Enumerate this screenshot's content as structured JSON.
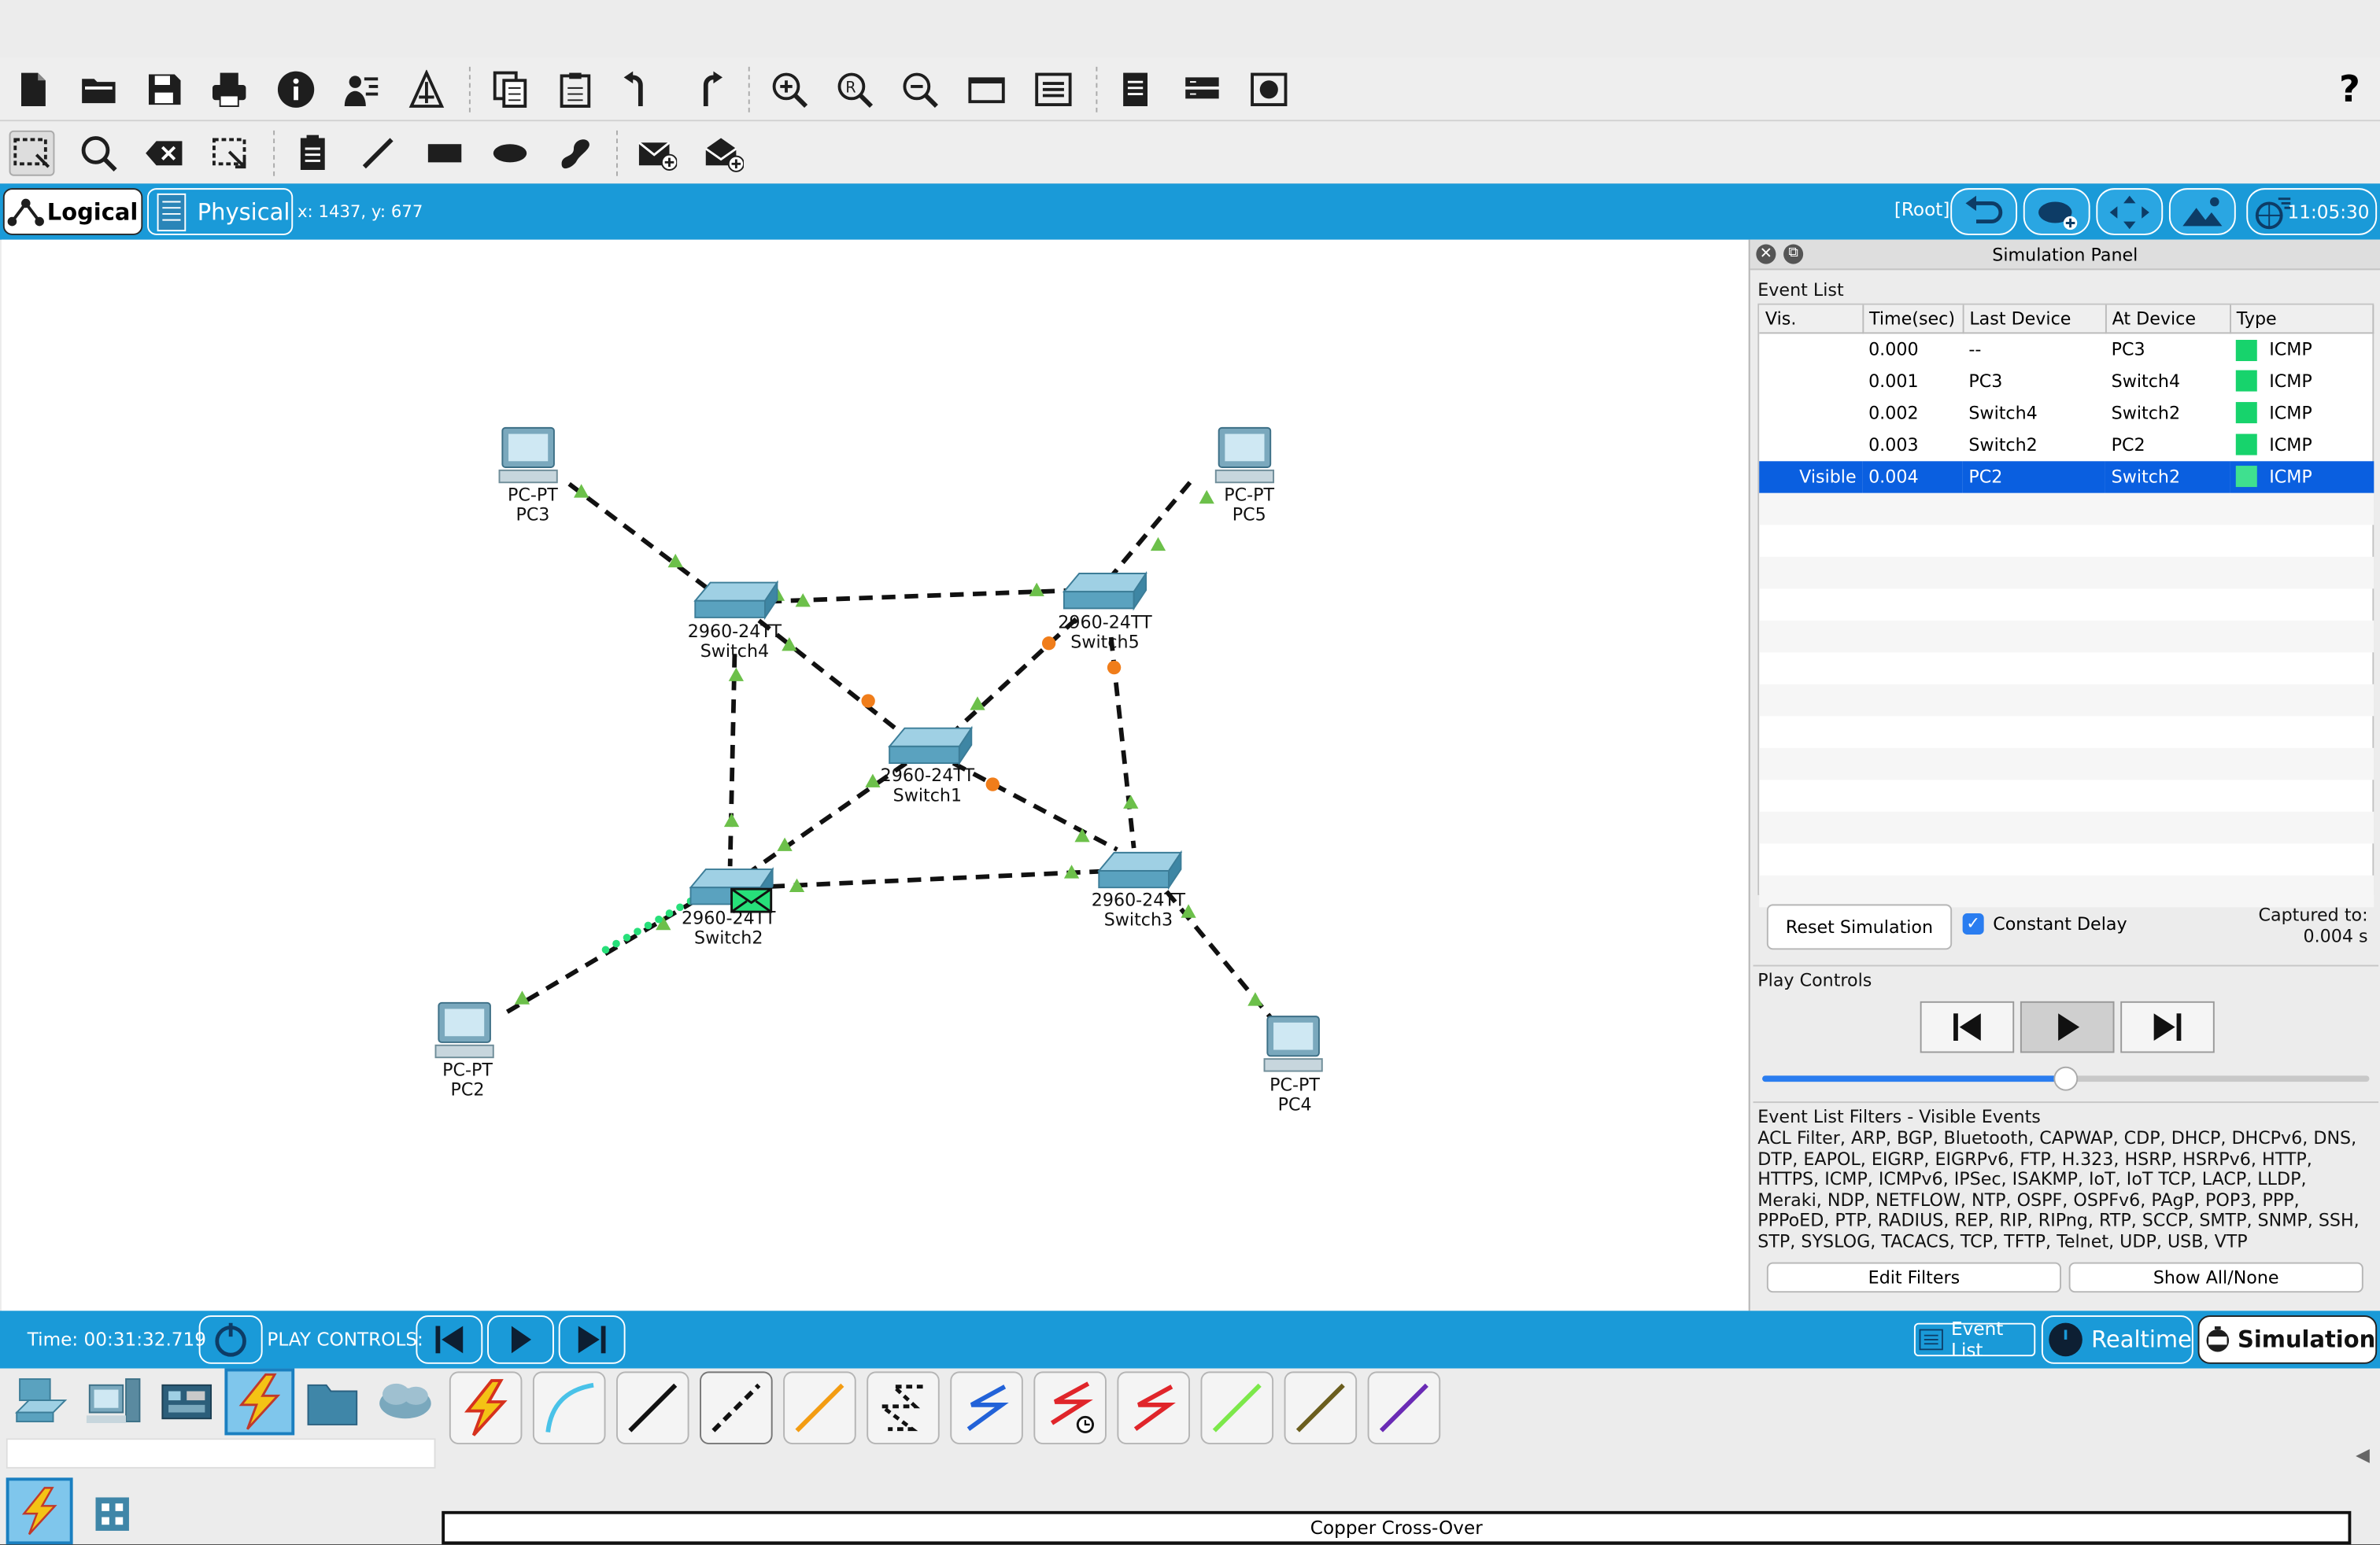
{
  "toolbar": {
    "help_label": "?"
  },
  "nav": {
    "logical_label": "Logical",
    "physical_label": "Physical",
    "coords": "x: 1437, y: 677",
    "root_label": "[Root]",
    "time": "11:05:30"
  },
  "devices": {
    "pc3": {
      "model": "PC-PT",
      "name": "PC3"
    },
    "pc5": {
      "model": "PC-PT",
      "name": "PC5"
    },
    "pc2": {
      "model": "PC-PT",
      "name": "PC2"
    },
    "pc4": {
      "model": "PC-PT",
      "name": "PC4"
    },
    "sw4": {
      "model": "2960-24TT",
      "name": "Switch4"
    },
    "sw5": {
      "model": "2960-24TT",
      "name": "Switch5"
    },
    "sw1": {
      "model": "2960-24TT",
      "name": "Switch1"
    },
    "sw2": {
      "model": "2960-24TT",
      "name": "Switch2"
    },
    "sw3": {
      "model": "2960-24TT",
      "name": "Switch3"
    }
  },
  "sim": {
    "title": "Simulation Panel",
    "event_list_label": "Event List",
    "columns": [
      "Vis.",
      "Time(sec)",
      "Last Device",
      "At Device",
      "Type"
    ],
    "events": [
      {
        "vis": "",
        "time": "0.000",
        "last": "--",
        "at": "PC3",
        "type": "ICMP"
      },
      {
        "vis": "",
        "time": "0.001",
        "last": "PC3",
        "at": "Switch4",
        "type": "ICMP"
      },
      {
        "vis": "",
        "time": "0.002",
        "last": "Switch4",
        "at": "Switch2",
        "type": "ICMP"
      },
      {
        "vis": "",
        "time": "0.003",
        "last": "Switch2",
        "at": "PC2",
        "type": "ICMP"
      },
      {
        "vis": "Visible",
        "time": "0.004",
        "last": "PC2",
        "at": "Switch2",
        "type": "ICMP"
      }
    ],
    "reset_label": "Reset Simulation",
    "constant_delay_label": "Constant Delay",
    "captured_label": "Captured to:",
    "captured_value": "0.004 s",
    "play_controls_label": "Play Controls",
    "slider_fraction": 0.5,
    "filters_title": "Event List Filters - Visible Events",
    "filters_text": "ACL Filter, ARP, BGP, Bluetooth, CAPWAP, CDP, DHCP, DHCPv6, DNS, DTP, EAPOL, EIGRP, EIGRPv6, FTP, H.323, HSRP, HSRPv6, HTTP, HTTPS, ICMP, ICMPv6, IPSec, ISAKMP, IoT, IoT TCP, LACP, LLDP, Meraki, NDP, NETFLOW, NTP, OSPF, OSPFv6, PAgP, POP3, PPP, PPPoED, PTP, RADIUS, REP, RIP, RIPng, RTP, SCCP, SMTP, SNMP, SSH, STP, SYSLOG, TACACS, TCP, TFTP, Telnet, UDP, USB, VTP",
    "edit_filters_label": "Edit Filters",
    "show_all_label": "Show All/None"
  },
  "bottom": {
    "time_label": "Time: 00:31:32.719",
    "play_controls_label": "PLAY CONTROLS:",
    "event_list_label": "Event List",
    "realtime_label": "Realtime",
    "simulation_label": "Simulation"
  },
  "status": {
    "selected_cable": "Copper Cross-Over"
  },
  "colors": {
    "accent": "#1a9ad8",
    "selected_row": "#0a5fe0",
    "icmp": "#17d36c",
    "link_up": "#6cc04a",
    "link_blocking": "#f07d1a"
  }
}
